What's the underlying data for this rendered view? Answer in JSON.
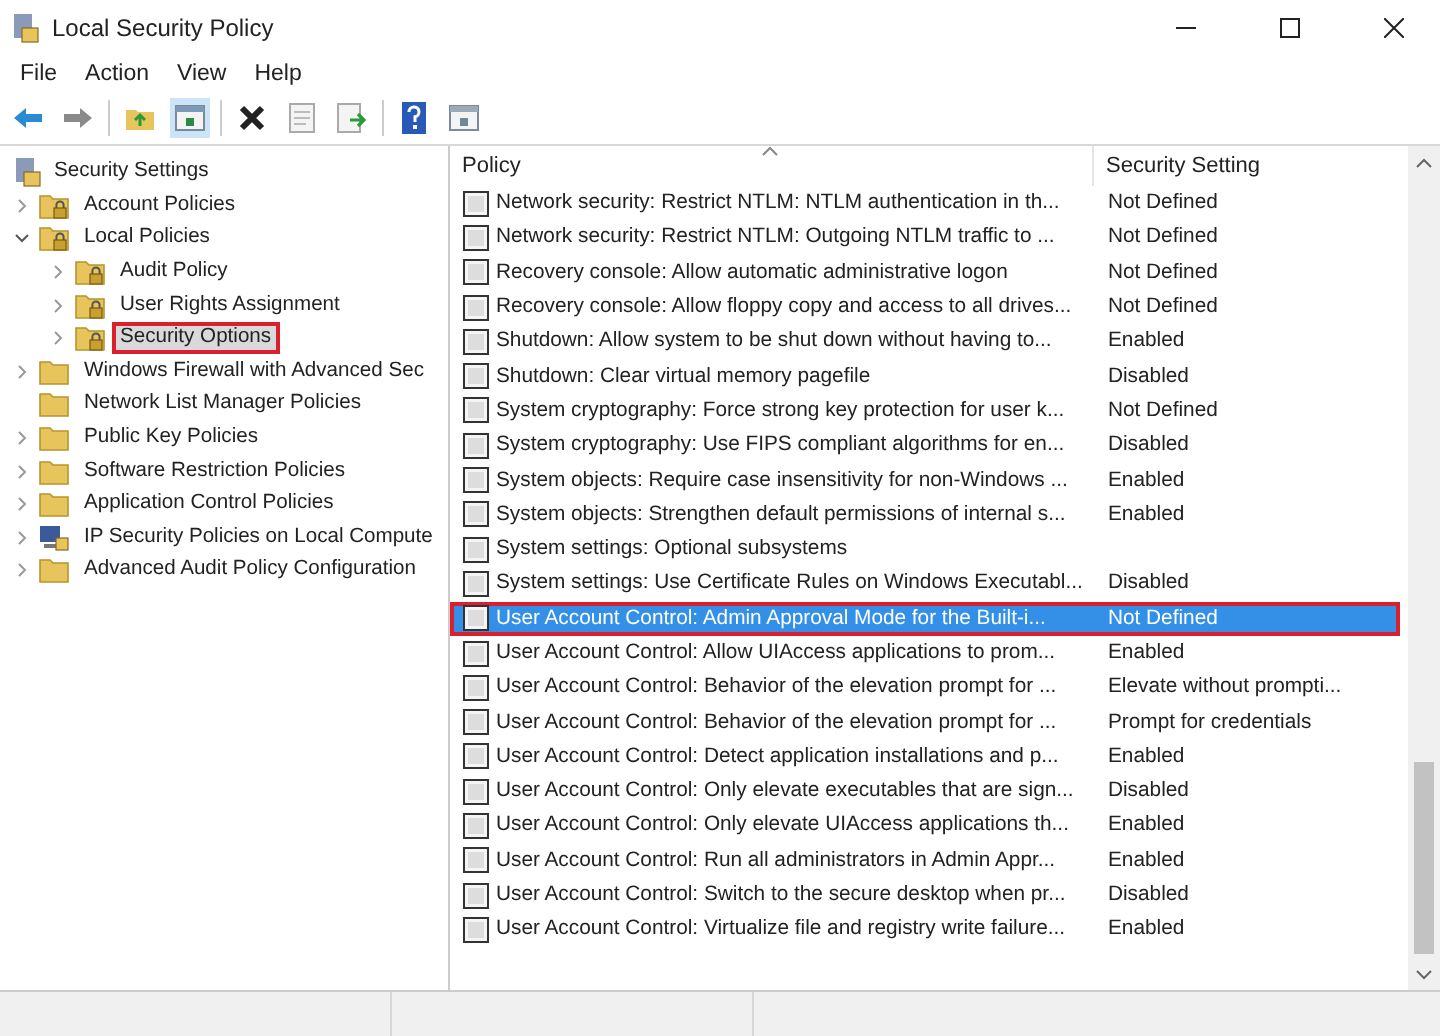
{
  "window": {
    "title": "Local Security Policy"
  },
  "menu": [
    "File",
    "Action",
    "View",
    "Help"
  ],
  "tree": {
    "label": "Security Settings",
    "children": [
      {
        "label": "Account Policies",
        "expanded": false,
        "selected": false,
        "annotated": false
      },
      {
        "label": "Local Policies",
        "expanded": true,
        "selected": false,
        "annotated": false,
        "children": [
          {
            "label": "Audit Policy",
            "expanded": false,
            "selected": false,
            "annotated": false
          },
          {
            "label": "User Rights Assignment",
            "expanded": false,
            "selected": false,
            "annotated": false
          },
          {
            "label": "Security Options",
            "expanded": false,
            "selected": true,
            "annotated": true
          }
        ]
      },
      {
        "label": "Windows Firewall with Advanced Sec",
        "expanded": false,
        "selected": false,
        "annotated": false
      },
      {
        "label": "Network List Manager Policies",
        "selected": false,
        "annotated": false
      },
      {
        "label": "Public Key Policies",
        "expanded": false,
        "selected": false,
        "annotated": false
      },
      {
        "label": "Software Restriction Policies",
        "expanded": false,
        "selected": false,
        "annotated": false
      },
      {
        "label": "Application Control Policies",
        "expanded": false,
        "selected": false,
        "annotated": false
      },
      {
        "label": "IP Security Policies on Local Compute",
        "kind": "network",
        "expanded": false,
        "selected": false,
        "annotated": false
      },
      {
        "label": "Advanced Audit Policy Configuration",
        "expanded": false,
        "selected": false,
        "annotated": false
      }
    ]
  },
  "table": {
    "columns": [
      "Policy",
      "Security Setting"
    ],
    "rows": [
      {
        "policy": "Network security: Restrict NTLM: NTLM authentication in th...",
        "setting": "Not Defined",
        "selected": false,
        "annotated": false
      },
      {
        "policy": "Network security: Restrict NTLM: Outgoing NTLM traffic to ...",
        "setting": "Not Defined",
        "selected": false,
        "annotated": false
      },
      {
        "policy": "Recovery console: Allow automatic administrative logon",
        "setting": "Not Defined",
        "selected": false,
        "annotated": false
      },
      {
        "policy": "Recovery console: Allow floppy copy and access to all drives...",
        "setting": "Not Defined",
        "selected": false,
        "annotated": false
      },
      {
        "policy": "Shutdown: Allow system to be shut down without having to...",
        "setting": "Enabled",
        "selected": false,
        "annotated": false
      },
      {
        "policy": "Shutdown: Clear virtual memory pagefile",
        "setting": "Disabled",
        "selected": false,
        "annotated": false
      },
      {
        "policy": "System cryptography: Force strong key protection for user k...",
        "setting": "Not Defined",
        "selected": false,
        "annotated": false
      },
      {
        "policy": "System cryptography: Use FIPS compliant algorithms for en...",
        "setting": "Disabled",
        "selected": false,
        "annotated": false
      },
      {
        "policy": "System objects: Require case insensitivity for non-Windows ...",
        "setting": "Enabled",
        "selected": false,
        "annotated": false
      },
      {
        "policy": "System objects: Strengthen default permissions of internal s...",
        "setting": "Enabled",
        "selected": false,
        "annotated": false
      },
      {
        "policy": "System settings: Optional subsystems",
        "selected": false,
        "annotated": false
      },
      {
        "policy": "System settings: Use Certificate Rules on Windows Executabl...",
        "setting": "Disabled",
        "selected": false,
        "annotated": false
      },
      {
        "policy": "User Account Control: Admin Approval Mode for the Built-i...",
        "setting": "Not Defined",
        "selected": true,
        "annotated": true
      },
      {
        "policy": "User Account Control: Allow UIAccess applications to prom...",
        "setting": "Enabled",
        "selected": false,
        "annotated": false
      },
      {
        "policy": "User Account Control: Behavior of the elevation prompt for ...",
        "setting": "Elevate without prompti...",
        "selected": false,
        "annotated": false
      },
      {
        "policy": "User Account Control: Behavior of the elevation prompt for ...",
        "setting": "Prompt for credentials",
        "selected": false,
        "annotated": false
      },
      {
        "policy": "User Account Control: Detect application installations and p...",
        "setting": "Enabled",
        "selected": false,
        "annotated": false
      },
      {
        "policy": "User Account Control: Only elevate executables that are sign...",
        "setting": "Disabled",
        "selected": false,
        "annotated": false
      },
      {
        "policy": "User Account Control: Only elevate UIAccess applications th...",
        "setting": "Enabled",
        "selected": false,
        "annotated": false
      },
      {
        "policy": "User Account Control: Run all administrators in Admin Appr...",
        "setting": "Enabled",
        "selected": false,
        "annotated": false
      },
      {
        "policy": "User Account Control: Switch to the secure desktop when pr...",
        "setting": "Disabled",
        "selected": false,
        "annotated": false
      },
      {
        "policy": "User Account Control: Virtualize file and registry write failure...",
        "setting": "Enabled",
        "selected": false,
        "annotated": false
      }
    ]
  }
}
